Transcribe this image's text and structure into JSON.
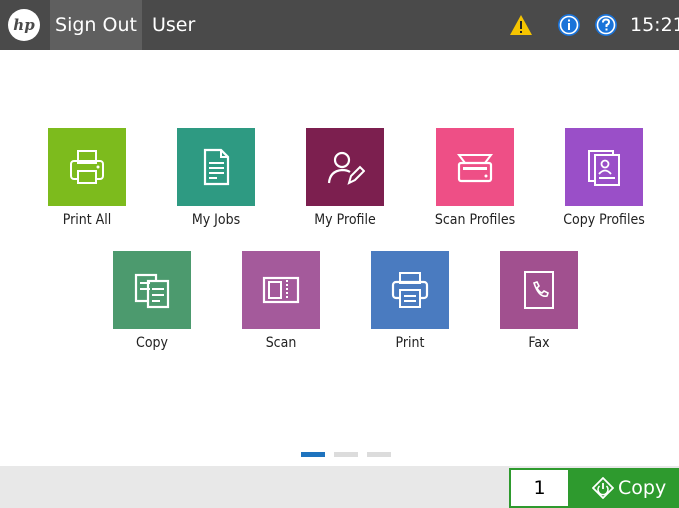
{
  "topbar": {
    "logo_text": "hp",
    "sign_out": "Sign Out",
    "user": "User",
    "time": "15:21",
    "icons": [
      "warning-icon",
      "info-icon",
      "help-icon"
    ]
  },
  "apps": [
    {
      "label": "Print All",
      "icon": "printer-icon",
      "color": "#7dbb1d"
    },
    {
      "label": "My Jobs",
      "icon": "document-icon",
      "color": "#2e9a82"
    },
    {
      "label": "My Profile",
      "icon": "person-pen-icon",
      "color": "#7c1f4f"
    },
    {
      "label": "Scan Profiles",
      "icon": "scanner-icon",
      "color": "#ee4f86"
    },
    {
      "label": "Copy Profiles",
      "icon": "profile-card-icon",
      "color": "#9a4fc8"
    },
    {
      "label": "Copy",
      "icon": "copy-documents-icon",
      "color": "#4c9a6e"
    },
    {
      "label": "Scan",
      "icon": "scan-page-icon",
      "color": "#a45a9b"
    },
    {
      "label": "Print",
      "icon": "print-icon",
      "color": "#4a7bc0"
    },
    {
      "label": "Fax",
      "icon": "fax-phone-icon",
      "color": "#a1508f"
    }
  ],
  "pager": {
    "pages": 3,
    "active": 1
  },
  "bottombar": {
    "copies": "1",
    "copy_label": "Copy",
    "accent": "#2e9a2e"
  }
}
